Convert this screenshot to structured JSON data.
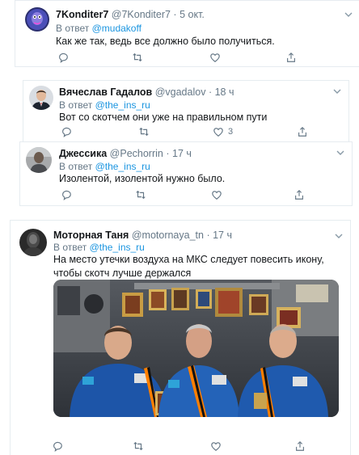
{
  "tweets": [
    {
      "name": "7Konditer7",
      "handle": "@7Konditer7",
      "dot": "·",
      "time": "5 окт.",
      "reply_prefix": "В ответ",
      "reply_to": "@mudakoff",
      "text": "Как же так, ведь все должно было получиться.",
      "likes": "",
      "avatar_icon": "cartoon-avatar"
    },
    {
      "name": "Вячеслав Гадалов",
      "handle": "@vgadalov",
      "dot": "·",
      "time": "18 ч",
      "reply_prefix": "В ответ",
      "reply_to": "@the_ins_ru",
      "text": "Вот со скотчем они уже на правильном пути",
      "likes": "3",
      "avatar_icon": "man-in-suit-avatar"
    },
    {
      "name": "Джессика",
      "handle": "@Pechorrin",
      "dot": "·",
      "time": "17 ч",
      "reply_prefix": "В ответ",
      "reply_to": "@the_ins_ru",
      "text": "Изолентой, изолентой нужно было.",
      "likes": "",
      "avatar_icon": "person-photo-avatar"
    },
    {
      "name": "Моторная Таня",
      "handle": "@motornaya_tn",
      "dot": "·",
      "time": "17 ч",
      "reply_prefix": "В ответ",
      "reply_to": "@the_ins_ru",
      "text": "На место утечки воздуха на МКС следует повесить икону, чтобы скотч лучше держался",
      "likes": "",
      "avatar_icon": "dark-photo-avatar",
      "photo_icon": "astronauts-with-icon-photo"
    }
  ],
  "colors": {
    "link": "#1b95e0",
    "muted": "#657786",
    "text": "#14171a",
    "border": "#e6ecf0"
  }
}
